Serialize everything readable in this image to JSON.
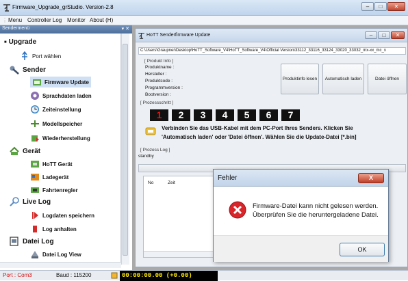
{
  "window": {
    "title": "Firmware_Upgrade_grStudio.  Version-2.8"
  },
  "menu": {
    "items": [
      "Menu",
      "Controller Log",
      "Monitor",
      "About (H)"
    ]
  },
  "sidebar": {
    "header": "Sendermenü",
    "sections": [
      {
        "label": "Upgrade",
        "items": [
          "Port wählen"
        ]
      },
      {
        "label": "Sender",
        "items": [
          "Firmware Update",
          "Sprachdaten laden",
          "Zeiteinstellung",
          "Modellspeicher",
          "Wiederherstellung"
        ]
      },
      {
        "label": "Gerät",
        "items": [
          "HoTT Gerät",
          "Ladegerät",
          "Fahrtenregler"
        ]
      },
      {
        "label": "Live Log",
        "items": [
          "Logdaten speichern",
          "Log anhalten"
        ]
      },
      {
        "label": "Datei Log",
        "items": [
          "Datei Log View"
        ]
      }
    ],
    "selected": "Firmware Update"
  },
  "inner_window": {
    "title": "HoTT Senderfirmware Update",
    "path": "C:\\Users\\Graupner\\Desktop\\HoTT_Software_V4\\HoTT_Software_V4\\Official Version\\33112_33116_33124_33020_33032_mx-xx_mc_x",
    "produkt_info_label": "[ Produkt Info ]",
    "produkt_fields": [
      "Produktname :",
      "Hersteller :",
      "Produktcode :",
      "Programmversion :",
      "Bootversion :"
    ],
    "buttons": [
      "Produktinfo lesen",
      "Automatisch laden",
      "Datei öffnen"
    ],
    "prozessschritt_label": "[ Prozessschritt ]",
    "steps": [
      "1",
      "2",
      "3",
      "4",
      "5",
      "6",
      "7"
    ],
    "active_step": "1",
    "instruction_line1": "Verbinden Sie das USB-Kabel mit dem PC-Port Ihres Senders.  Klicken Sie",
    "instruction_line2": "'Automatisch laden' oder 'Datei öffnen'. Wählen Sie die Update-Datei [*.bin]",
    "prozess_log_label": "[ Prozess Log ]",
    "status_text": "standby",
    "log_columns": [
      "No",
      "Zeit"
    ]
  },
  "dialog": {
    "title": "Fehler",
    "close_label": "X",
    "message_line1": "Firmware-Datei kann nicht gelesen werden.",
    "message_line2": "Überprüfen Sie die heruntergeladene Datei.",
    "ok_label": "OK"
  },
  "statusbar": {
    "port": "Port : Com3",
    "baud": "Baud : 115200",
    "timer": "00:00:00.00   (+0.00)"
  },
  "colors": {
    "port_text": "#d01010",
    "timer_text": "#ffe800",
    "active_step": "#e11111",
    "dialog_error": "#d8262b"
  }
}
